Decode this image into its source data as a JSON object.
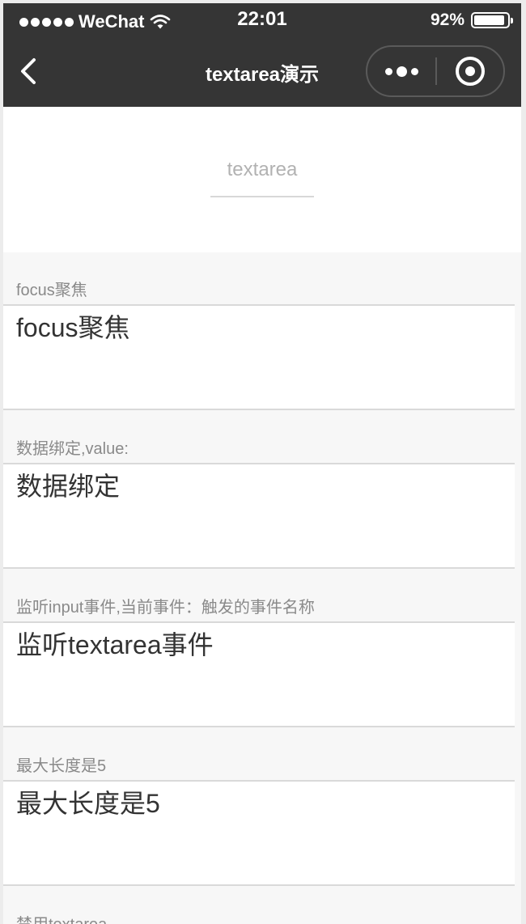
{
  "status_bar": {
    "carrier": "WeChat",
    "time": "22:01",
    "battery_pct": "92%",
    "battery_level": 0.92
  },
  "nav": {
    "title": "textarea演示"
  },
  "page": {
    "title": "textarea"
  },
  "sections": [
    {
      "label": "focus聚焦",
      "value": "focus聚焦"
    },
    {
      "label": "数据绑定,value:",
      "value": "数据绑定"
    },
    {
      "label": "监听input事件,当前事件：触发的事件名称",
      "value": "监听textarea事件"
    },
    {
      "label": "最大长度是5",
      "value": "最大长度是5"
    },
    {
      "label": "禁用textarea",
      "value": ""
    }
  ]
}
